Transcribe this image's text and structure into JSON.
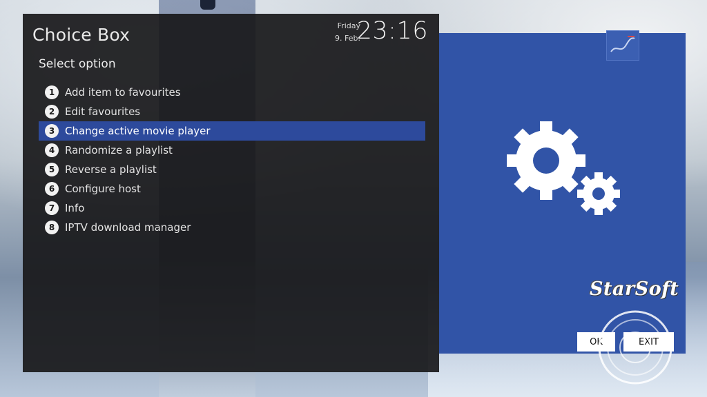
{
  "window": {
    "title": "Choice Box",
    "day": "Friday",
    "date": "9. Feb.",
    "time": "23:16",
    "subtitle": "Select option"
  },
  "menu": {
    "selected_index": 2,
    "items": [
      {
        "num": "1",
        "label": "Add item to favourites"
      },
      {
        "num": "2",
        "label": "Edit favourites"
      },
      {
        "num": "3",
        "label": "Change active movie player"
      },
      {
        "num": "4",
        "label": "Randomize a playlist"
      },
      {
        "num": "5",
        "label": "Reverse a playlist"
      },
      {
        "num": "6",
        "label": "Configure host"
      },
      {
        "num": "7",
        "label": "Info"
      },
      {
        "num": "8",
        "label": "IPTV download manager"
      }
    ]
  },
  "preview": {
    "icon": "gears-icon",
    "accent_color": "#3154a7"
  },
  "buttons": {
    "ok_label": "OK",
    "exit_label": "EXIT"
  },
  "watermark": {
    "text": "StarSoft"
  },
  "colors": {
    "panel_bg": "#18181a",
    "selection": "#2d4a9c"
  }
}
